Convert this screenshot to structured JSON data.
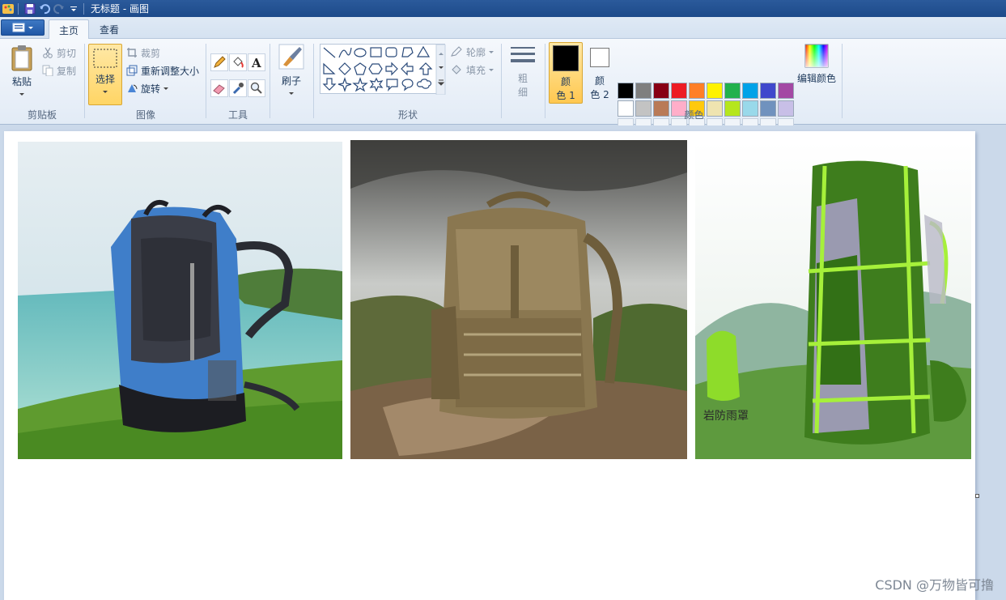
{
  "window": {
    "title": "无标题 - 画图"
  },
  "tabs": [
    {
      "label": "主页",
      "active": true
    },
    {
      "label": "查看",
      "active": false
    }
  ],
  "clipboard": {
    "paste_label": "粘贴",
    "cut_label": "剪切",
    "copy_label": "复制",
    "group_label": "剪贴板"
  },
  "image": {
    "select_label": "选择",
    "crop_label": "裁剪",
    "resize_label": "重新调整大小",
    "rotate_label": "旋转",
    "group_label": "图像"
  },
  "tools": {
    "group_label": "工具"
  },
  "brushes": {
    "label": "刷子"
  },
  "shapes": {
    "outline_label": "轮廓",
    "fill_label": "填充",
    "group_label": "形状"
  },
  "size": {
    "label_line1": "粗",
    "label_line2": "细"
  },
  "colors": {
    "color1_line1": "颜",
    "color1_line2": "色 1",
    "color2_line1": "颜",
    "color2_line2": "色 2",
    "edit_label": "编辑颜色",
    "group_label": "颜色",
    "color1_value": "#000000",
    "color2_value": "#ffffff",
    "palette_row1": [
      "#000000",
      "#7f7f7f",
      "#880015",
      "#ed1c24",
      "#ff7f27",
      "#fff200",
      "#22b14c",
      "#00a2e8",
      "#3f48cc",
      "#a349a4"
    ],
    "palette_row2": [
      "#ffffff",
      "#c3c3c3",
      "#b97a57",
      "#ffaec9",
      "#ffc90e",
      "#efe4b0",
      "#b5e61d",
      "#99d9ea",
      "#7092be",
      "#c8bfe7"
    ]
  },
  "canvas_images": [
    {
      "name": "blue-hiking-backpack-seaside"
    },
    {
      "name": "tactical-tan-backpack-rocks"
    },
    {
      "name": "green-hiking-backpack-mountain",
      "caption": "岩防雨罩"
    }
  ],
  "watermark": "CSDN @万物皆可撸"
}
